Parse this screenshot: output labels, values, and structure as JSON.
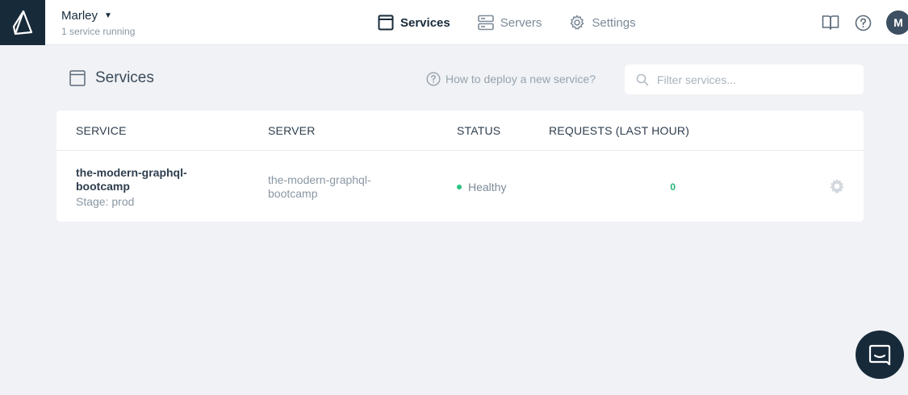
{
  "header": {
    "workspace_name": "Marley",
    "workspace_caret": "▼",
    "workspace_sub": "1 service running",
    "nav": [
      {
        "label": "Services",
        "icon": "window-icon",
        "active": true
      },
      {
        "label": "Servers",
        "icon": "server-icon",
        "active": false
      },
      {
        "label": "Settings",
        "icon": "gear-icon",
        "active": false
      }
    ],
    "avatar_initial": "M"
  },
  "page": {
    "title": "Services",
    "help_link": "How to deploy a new service?",
    "filter_placeholder": "Filter services..."
  },
  "table": {
    "columns": [
      "SERVICE",
      "SERVER",
      "STATUS",
      "REQUESTS (LAST HOUR)"
    ],
    "rows": [
      {
        "service": "the-modern-graphql-bootcamp",
        "stage": "Stage: prod",
        "server": "the-modern-graphql-bootcamp",
        "status": "Healthy",
        "requests": "0"
      }
    ]
  },
  "colors": {
    "brand_dark": "#172a3a",
    "healthy": "#27c281",
    "background": "#f0f2f5"
  }
}
